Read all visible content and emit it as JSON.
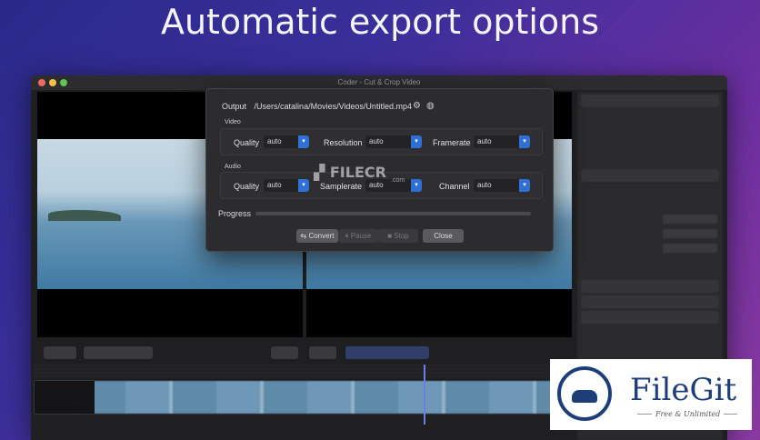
{
  "headline": "Automatic export options",
  "window": {
    "title": "Coder - Cut & Crop Video"
  },
  "dialog": {
    "output_label": "Output",
    "output_path": "/Users/catalina/Movies/Videos/Untitled.mp4",
    "video_group_title": "Video",
    "audio_group_title": "Audio",
    "video": {
      "quality_label": "Quality",
      "quality_value": "auto",
      "resolution_label": "Resolution",
      "resolution_value": "auto",
      "framerate_label": "Framerate",
      "framerate_value": "auto"
    },
    "audio": {
      "quality_label": "Quality",
      "quality_value": "auto",
      "samplerate_label": "Samplerate",
      "samplerate_value": "auto",
      "channel_label": "Channel",
      "channel_value": "auto"
    },
    "progress_label": "Progress",
    "progress_value": 0,
    "buttons": {
      "convert": "Convert",
      "pause": "Pause",
      "stop": "Stop",
      "close": "Close"
    }
  },
  "icons": {
    "gear": "gear-icon",
    "globe": "globe-icon",
    "dropdown": "chevron-down-icon"
  },
  "watermarks": {
    "filecr": "FILECR",
    "filecr_sub": ".com",
    "filegit_name": "FileGit",
    "filegit_tag": "Free & Unlimited"
  },
  "colors": {
    "accent": "#2f6fd6",
    "brand": "#1e3e7a"
  }
}
